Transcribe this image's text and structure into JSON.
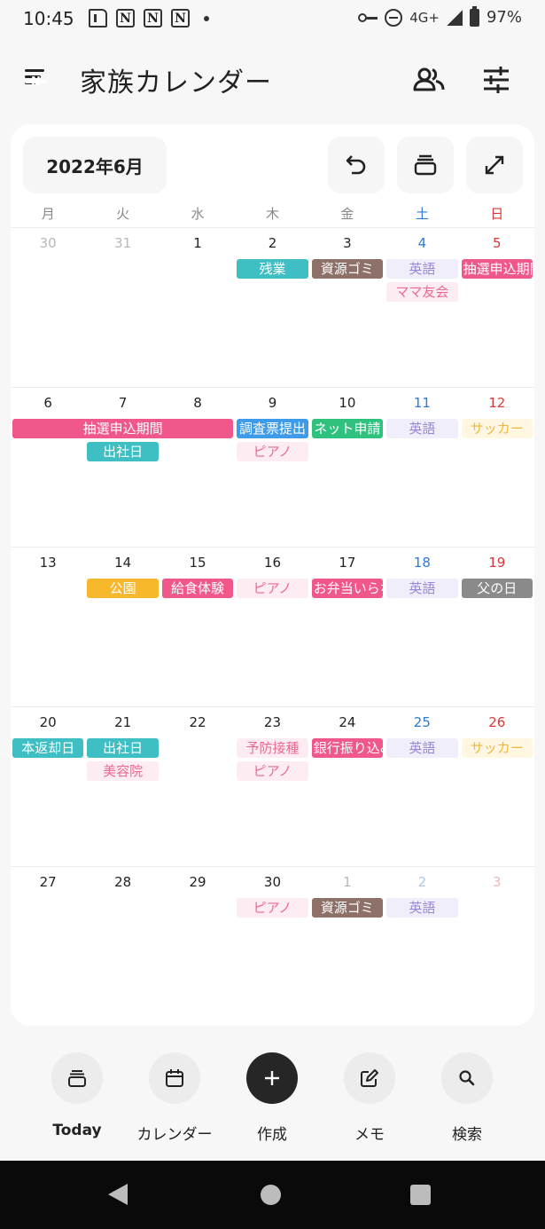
{
  "status_bar": {
    "time": "10:45",
    "notifications": [
      "document",
      "N",
      "N",
      "N"
    ],
    "network": "4G+",
    "battery": "97%"
  },
  "header": {
    "title": "家族カレンダー",
    "menu_badge": "N"
  },
  "calendar": {
    "month_label": "2022年6月",
    "weekdays": [
      "月",
      "火",
      "水",
      "木",
      "金",
      "土",
      "日"
    ],
    "weeks": [
      {
        "days": [
          {
            "d": "30",
            "out": true
          },
          {
            "d": "31",
            "out": true
          },
          {
            "d": "1"
          },
          {
            "d": "2"
          },
          {
            "d": "3"
          },
          {
            "d": "4"
          },
          {
            "d": "5"
          }
        ],
        "events": [
          {
            "label": "残業",
            "col": 3,
            "span": 1,
            "row": 0,
            "style": "teal"
          },
          {
            "label": "資源ゴミ",
            "col": 4,
            "span": 1,
            "row": 0,
            "style": "brown"
          },
          {
            "label": "英語",
            "col": 5,
            "span": 1,
            "row": 0,
            "style": "lavender"
          },
          {
            "label": "抽選申込期間",
            "col": 6,
            "span": 1,
            "row": 0,
            "style": "pink"
          },
          {
            "label": "ママ友会",
            "col": 5,
            "span": 1,
            "row": 1,
            "style": "lightpink"
          }
        ]
      },
      {
        "days": [
          {
            "d": "6"
          },
          {
            "d": "7"
          },
          {
            "d": "8"
          },
          {
            "d": "9"
          },
          {
            "d": "10"
          },
          {
            "d": "11"
          },
          {
            "d": "12"
          }
        ],
        "events": [
          {
            "label": "抽選申込期間",
            "col": 0,
            "span": 3,
            "row": 0,
            "style": "pink"
          },
          {
            "label": "調査票提出",
            "col": 3,
            "span": 1,
            "row": 0,
            "style": "blue"
          },
          {
            "label": "ネット申請",
            "col": 4,
            "span": 1,
            "row": 0,
            "style": "green"
          },
          {
            "label": "英語",
            "col": 5,
            "span": 1,
            "row": 0,
            "style": "lavender"
          },
          {
            "label": "サッカー",
            "col": 6,
            "span": 1,
            "row": 0,
            "style": "lightyellow"
          },
          {
            "label": "出社日",
            "col": 1,
            "span": 1,
            "row": 1,
            "style": "teal"
          },
          {
            "label": "ピアノ",
            "col": 3,
            "span": 1,
            "row": 1,
            "style": "lightpink"
          }
        ]
      },
      {
        "days": [
          {
            "d": "13"
          },
          {
            "d": "14"
          },
          {
            "d": "15"
          },
          {
            "d": "16"
          },
          {
            "d": "17"
          },
          {
            "d": "18"
          },
          {
            "d": "19"
          }
        ],
        "events": [
          {
            "label": "公園",
            "col": 1,
            "span": 1,
            "row": 0,
            "style": "yellow"
          },
          {
            "label": "給食体験",
            "col": 2,
            "span": 1,
            "row": 0,
            "style": "pink"
          },
          {
            "label": "ピアノ",
            "col": 3,
            "span": 1,
            "row": 0,
            "style": "lightpink"
          },
          {
            "label": "お弁当いらない",
            "col": 4,
            "span": 1,
            "row": 0,
            "style": "pink"
          },
          {
            "label": "英語",
            "col": 5,
            "span": 1,
            "row": 0,
            "style": "lavender"
          },
          {
            "label": "父の日",
            "col": 6,
            "span": 1,
            "row": 0,
            "style": "gray"
          }
        ]
      },
      {
        "days": [
          {
            "d": "20"
          },
          {
            "d": "21"
          },
          {
            "d": "22"
          },
          {
            "d": "23"
          },
          {
            "d": "24"
          },
          {
            "d": "25"
          },
          {
            "d": "26"
          }
        ],
        "events": [
          {
            "label": "本返却日",
            "col": 0,
            "span": 1,
            "row": 0,
            "style": "teal"
          },
          {
            "label": "出社日",
            "col": 1,
            "span": 1,
            "row": 0,
            "style": "teal"
          },
          {
            "label": "予防接種",
            "col": 3,
            "span": 1,
            "row": 0,
            "style": "lightpink"
          },
          {
            "label": "銀行振り込み",
            "col": 4,
            "span": 1,
            "row": 0,
            "style": "pink"
          },
          {
            "label": "英語",
            "col": 5,
            "span": 1,
            "row": 0,
            "style": "lavender"
          },
          {
            "label": "サッカー",
            "col": 6,
            "span": 1,
            "row": 0,
            "style": "lightyellow"
          },
          {
            "label": "美容院",
            "col": 1,
            "span": 1,
            "row": 1,
            "style": "lightpink"
          },
          {
            "label": "ピアノ",
            "col": 3,
            "span": 1,
            "row": 1,
            "style": "lightpink"
          }
        ]
      },
      {
        "days": [
          {
            "d": "27"
          },
          {
            "d": "28"
          },
          {
            "d": "29"
          },
          {
            "d": "30"
          },
          {
            "d": "1",
            "out": true
          },
          {
            "d": "2",
            "out": true
          },
          {
            "d": "3",
            "out": true
          }
        ],
        "events": [
          {
            "label": "ピアノ",
            "col": 3,
            "span": 1,
            "row": 0,
            "style": "lightpink"
          },
          {
            "label": "資源ゴミ",
            "col": 4,
            "span": 1,
            "row": 0,
            "style": "brown"
          },
          {
            "label": "英語",
            "col": 5,
            "span": 1,
            "row": 0,
            "style": "lavender"
          }
        ]
      }
    ]
  },
  "event_styles": {
    "teal": {
      "bg": "#3fbfc4",
      "fg": "#ffffff"
    },
    "brown": {
      "bg": "#8d7068",
      "fg": "#ffffff"
    },
    "lavender": {
      "bg": "#f1eefb",
      "fg": "#9a86d8"
    },
    "pink": {
      "bg": "#f0578a",
      "fg": "#ffffff"
    },
    "lightpink": {
      "bg": "#fdecf1",
      "fg": "#ec6a92"
    },
    "blue": {
      "bg": "#3d9be9",
      "fg": "#ffffff"
    },
    "green": {
      "bg": "#2ec27e",
      "fg": "#ffffff"
    },
    "lightyellow": {
      "bg": "#fff7e2",
      "fg": "#f3b53c"
    },
    "yellow": {
      "bg": "#f8b82c",
      "fg": "#ffffff"
    },
    "gray": {
      "bg": "#8a8a8a",
      "fg": "#ffffff"
    }
  },
  "bottom_nav": [
    {
      "label": "Today",
      "icon": "stack-icon",
      "bold": true
    },
    {
      "label": "カレンダー",
      "icon": "calendar-icon"
    },
    {
      "label": "作成",
      "icon": "plus-icon",
      "dark": true
    },
    {
      "label": "メモ",
      "icon": "edit-icon"
    },
    {
      "label": "検索",
      "icon": "search-icon"
    }
  ]
}
